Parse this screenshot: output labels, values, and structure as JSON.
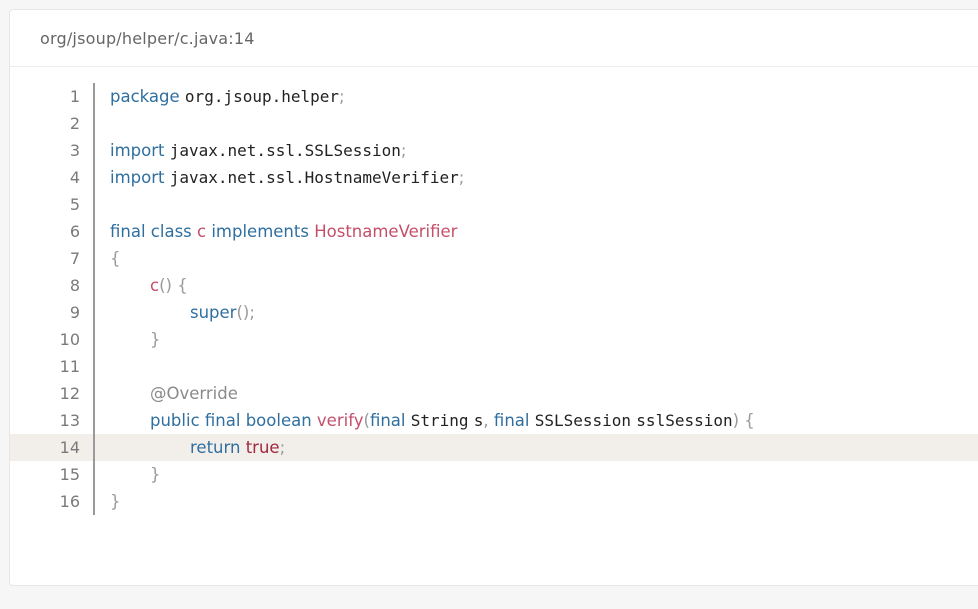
{
  "file_header": "org/jsoup/helper/c.java:14",
  "lines": {
    "l1": {
      "num": "1",
      "kw": "package",
      "name": "org.jsoup.helper",
      "semi": ";"
    },
    "l2": {
      "num": "2"
    },
    "l3": {
      "num": "3",
      "kw": "import",
      "name": "javax.net.ssl.SSLSession",
      "semi": ";"
    },
    "l4": {
      "num": "4",
      "kw": "import",
      "name": "javax.net.ssl.HostnameVerifier",
      "semi": ";"
    },
    "l5": {
      "num": "5"
    },
    "l6": {
      "num": "6",
      "kw1": "final",
      "kw2": "class",
      "cls": "c",
      "kw3": "implements",
      "iface": "HostnameVerifier"
    },
    "l7": {
      "num": "7",
      "brace": "{"
    },
    "l8": {
      "num": "8",
      "ctor": "c",
      "rest": "() {"
    },
    "l9": {
      "num": "9",
      "kw": "super",
      "rest": "();"
    },
    "l10": {
      "num": "10",
      "brace": "}"
    },
    "l11": {
      "num": "11"
    },
    "l12": {
      "num": "12",
      "annotation": "@Override"
    },
    "l13": {
      "num": "13",
      "kw1": "public",
      "kw2": "final",
      "kw3": "boolean",
      "method": "verify",
      "open": "(",
      "kw4": "final",
      "t1": "String",
      "p1": "s",
      "comma": ",",
      "kw5": "final",
      "t2": "SSLSession",
      "p2": "sslSession",
      "close": ") {"
    },
    "l14": {
      "num": "14",
      "kw": "return",
      "lit": "true",
      "semi": ";"
    },
    "l15": {
      "num": "15",
      "brace": "}"
    },
    "l16": {
      "num": "16",
      "brace": "}"
    }
  },
  "colors": {
    "keyword": "#2f6f9f",
    "type": "#c44f6a",
    "literal": "#a0283f",
    "highlight_line": "#f2efeb"
  }
}
